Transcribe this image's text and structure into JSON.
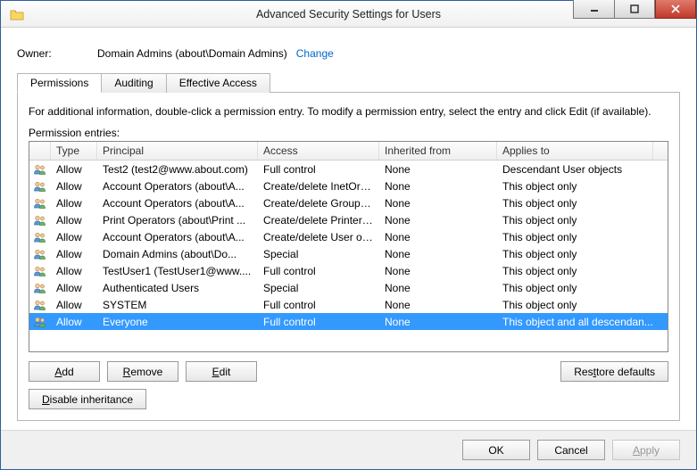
{
  "window": {
    "title": "Advanced Security Settings for Users"
  },
  "owner": {
    "label": "Owner:",
    "value": "Domain Admins (about\\Domain Admins)",
    "change_link": "Change"
  },
  "tabs": {
    "permissions": "Permissions",
    "auditing": "Auditing",
    "effective": "Effective Access"
  },
  "instructions": "For additional information, double-click a permission entry. To modify a permission entry, select the entry and click Edit (if available).",
  "entries_label": "Permission entries:",
  "columns": {
    "icon": "",
    "type": "Type",
    "principal": "Principal",
    "access": "Access",
    "inherited": "Inherited from",
    "applies": "Applies to"
  },
  "rows": [
    {
      "type": "Allow",
      "principal": "Test2 (test2@www.about.com)",
      "access": "Full control",
      "inherited": "None",
      "applies": "Descendant User objects",
      "selected": false
    },
    {
      "type": "Allow",
      "principal": "Account Operators (about\\A...",
      "access": "Create/delete InetOrg...",
      "inherited": "None",
      "applies": "This object only",
      "selected": false
    },
    {
      "type": "Allow",
      "principal": "Account Operators (about\\A...",
      "access": "Create/delete Group o...",
      "inherited": "None",
      "applies": "This object only",
      "selected": false
    },
    {
      "type": "Allow",
      "principal": "Print Operators (about\\Print ...",
      "access": "Create/delete Printer o...",
      "inherited": "None",
      "applies": "This object only",
      "selected": false
    },
    {
      "type": "Allow",
      "principal": "Account Operators (about\\A...",
      "access": "Create/delete User obj...",
      "inherited": "None",
      "applies": "This object only",
      "selected": false
    },
    {
      "type": "Allow",
      "principal": "Domain Admins (about\\Do...",
      "access": "Special",
      "inherited": "None",
      "applies": "This object only",
      "selected": false
    },
    {
      "type": "Allow",
      "principal": "TestUser1 (TestUser1@www....",
      "access": "Full control",
      "inherited": "None",
      "applies": "This object only",
      "selected": false
    },
    {
      "type": "Allow",
      "principal": "Authenticated Users",
      "access": "Special",
      "inherited": "None",
      "applies": "This object only",
      "selected": false
    },
    {
      "type": "Allow",
      "principal": "SYSTEM",
      "access": "Full control",
      "inherited": "None",
      "applies": "This object only",
      "selected": false
    },
    {
      "type": "Allow",
      "principal": "Everyone",
      "access": "Full control",
      "inherited": "None",
      "applies": "This object and all descendan...",
      "selected": true
    }
  ],
  "buttons": {
    "add": "dd",
    "add_u": "A",
    "remove": "emove",
    "remove_u": "R",
    "edit": "dit",
    "edit_u": "E",
    "restore": "tore defaults",
    "restore_pre": "Res",
    "disable": "isable inheritance",
    "disable_u": "D",
    "ok": "OK",
    "cancel": "Cancel",
    "apply": "pply",
    "apply_u": "A"
  }
}
